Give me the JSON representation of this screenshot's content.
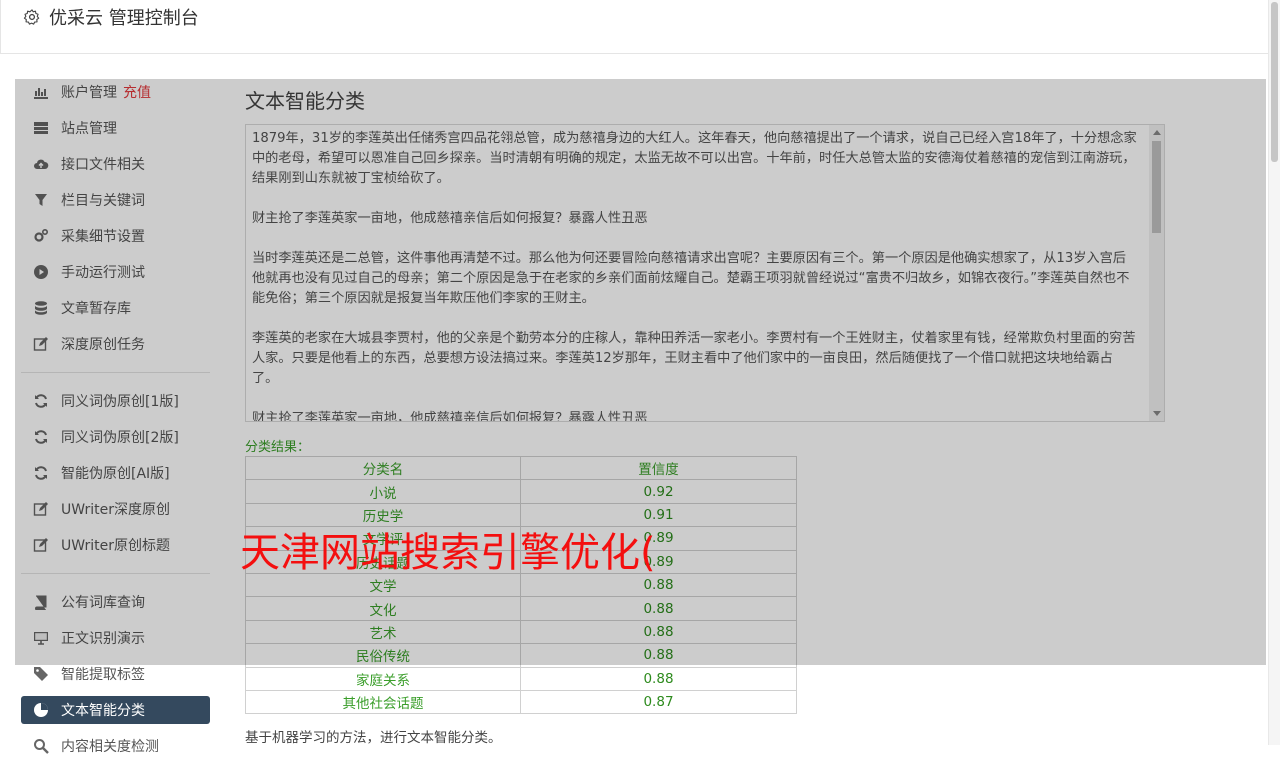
{
  "header": {
    "title": "优采云 管理控制台"
  },
  "sidebar": {
    "groups": [
      [
        {
          "label": "账户管理",
          "badge": "充值",
          "icon": "bar-chart-icon"
        },
        {
          "label": "站点管理",
          "icon": "server-icon"
        },
        {
          "label": "接口文件相关",
          "icon": "cloud-upload-icon"
        },
        {
          "label": "栏目与关键词",
          "icon": "filter-icon"
        },
        {
          "label": "采集细节设置",
          "icon": "cogs-icon"
        },
        {
          "label": "手动运行测试",
          "icon": "play-circle-icon"
        },
        {
          "label": "文章暂存库",
          "icon": "database-icon"
        },
        {
          "label": "深度原创任务",
          "icon": "edit-icon"
        }
      ],
      [
        {
          "label": "同义词伪原创[1版]",
          "icon": "refresh-icon"
        },
        {
          "label": "同义词伪原创[2版]",
          "icon": "refresh-icon"
        },
        {
          "label": "智能伪原创[AI版]",
          "icon": "refresh-icon"
        },
        {
          "label": "UWriter深度原创",
          "icon": "edit-icon"
        },
        {
          "label": "UWriter原创标题",
          "icon": "edit-icon"
        }
      ],
      [
        {
          "label": "公有词库查询",
          "icon": "book-icon"
        },
        {
          "label": "正文识别演示",
          "icon": "desktop-icon"
        },
        {
          "label": "智能提取标签",
          "icon": "tag-icon"
        },
        {
          "label": "文本智能分类",
          "icon": "pie-chart-icon",
          "active": true
        },
        {
          "label": "内容相关度检测",
          "icon": "search-icon"
        }
      ]
    ]
  },
  "main": {
    "heading": "文本智能分类",
    "article": "1879年，31岁的李莲英出任储秀宫四品花翎总管，成为慈禧身边的大红人。这年春天，他向慈禧提出了一个请求，说自己已经入宫18年了，十分想念家中的老母，希望可以恩准自己回乡探亲。当时清朝有明确的规定，太监无故不可以出宫。十年前，时任大总管太监的安德海仗着慈禧的宠信到江南游玩，结果刚到山东就被丁宝桢给砍了。\n\n财主抢了李莲英家一亩地，他成慈禧亲信后如何报复？暴露人性丑恶\n\n当时李莲英还是二总管，这件事他再清楚不过。那么他为何还要冒险向慈禧请求出宫呢？主要原因有三个。第一个原因是他确实想家了，从13岁入宫后他就再也没有见过自己的母亲；第二个原因是急于在老家的乡亲们面前炫耀自己。楚霸王项羽就曾经说过“富贵不归故乡，如锦衣夜行。”李莲英自然也不能免俗；第三个原因就是报复当年欺压他们李家的王财主。\n\n李莲英的老家在大城县李贾村，他的父亲是个勤劳本分的庄稼人，靠种田养活一家老小。李贾村有一个王姓财主，仗着家里有钱，经常欺负村里面的穷苦人家。只要是他看上的东西，总要想方设法搞过来。李莲英12岁那年，王财主看中了他们家中的一亩良田，然后随便找了一个借口就把这块地给霸占了。\n\n财主抢了李莲英家一亩地，他成慈禧亲信后如何报复？暴露人性丑恶",
    "result_label": "分类结果：",
    "table": {
      "headers": [
        "分类名",
        "置信度"
      ],
      "rows": [
        [
          "小说",
          "0.92"
        ],
        [
          "历史学",
          "0.91"
        ],
        [
          "文学评",
          "0.89"
        ],
        [
          "历史话题",
          "0.89"
        ],
        [
          "文学",
          "0.88"
        ],
        [
          "文化",
          "0.88"
        ],
        [
          "艺术",
          "0.88"
        ],
        [
          "民俗传统",
          "0.88"
        ],
        [
          "家庭关系",
          "0.88"
        ],
        [
          "其他社会话题",
          "0.87"
        ]
      ]
    },
    "footnote": "基于机器学习的方法，进行文本智能分类。"
  },
  "overlay": {
    "text": "天津网站搜索引擎优化("
  },
  "colors": {
    "accent_green": "#3a9e2a",
    "active_nav": "#34495e",
    "badge_red": "#e4393c",
    "overlay_text": "#f40f0f"
  }
}
